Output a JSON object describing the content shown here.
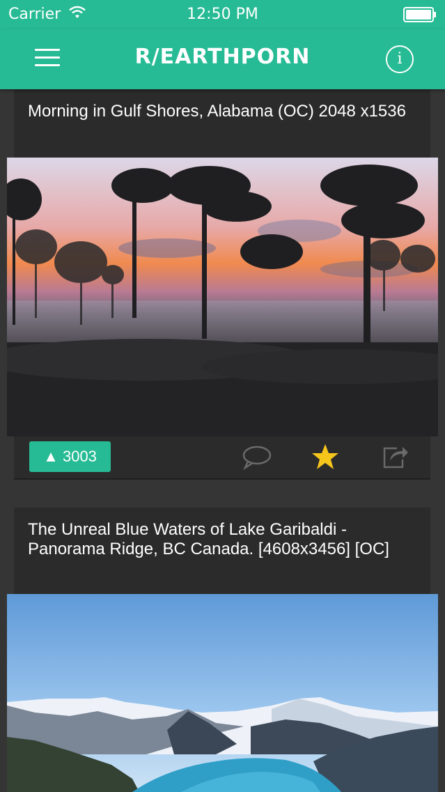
{
  "status_bar": {
    "carrier": "Carrier",
    "time": "12:50 PM"
  },
  "nav": {
    "title": "R/EARTHPORN",
    "info_label": "i"
  },
  "posts": [
    {
      "title": "Morning in Gulf Shores, Alabama (OC) 2048 x1536",
      "upvotes": "3003",
      "upvote_arrow": "▲",
      "favorited": true
    },
    {
      "title": "The Unreal Blue Waters of Lake Garibaldi - Panorama Ridge, BC Canada. [4608x3456] [OC]"
    }
  ],
  "colors": {
    "accent": "#26bb94",
    "star": "#f6c51c",
    "background": "#353535"
  }
}
